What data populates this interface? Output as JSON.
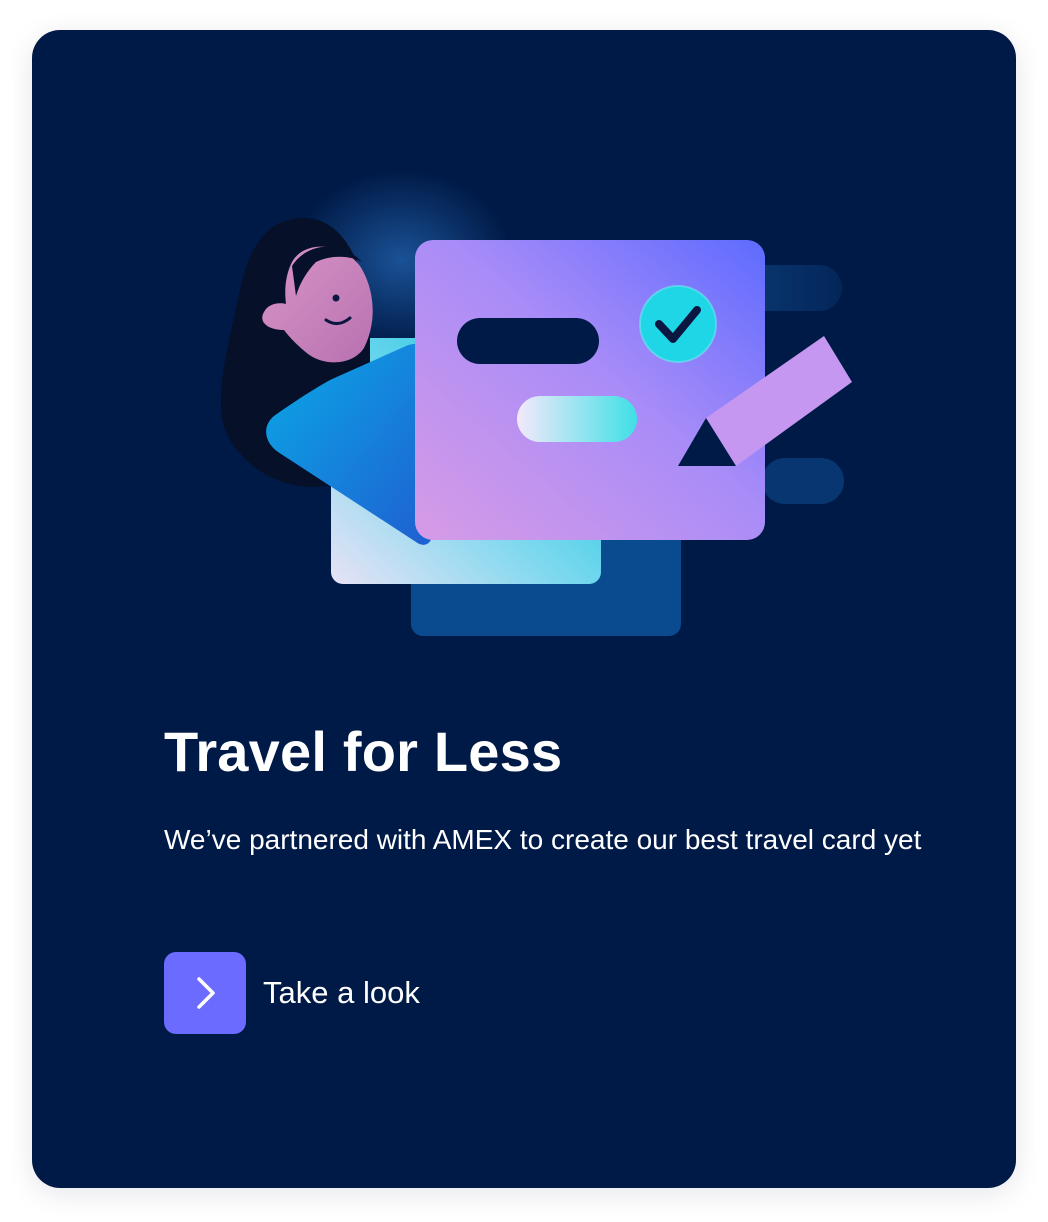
{
  "card": {
    "title": "Travel for Less",
    "description": "We’ve partnered with AMEX to create our best travel card yet",
    "cta": {
      "label": "Take a look",
      "icon": "chevron-right-icon"
    }
  },
  "illustration": {
    "subject": "woman holding travel card with checkmark and pencil",
    "icons": [
      "checkmark-icon",
      "pencil-icon"
    ]
  },
  "colors": {
    "card_background": "#001a47",
    "accent": "#6b6bff",
    "text": "#ffffff"
  }
}
